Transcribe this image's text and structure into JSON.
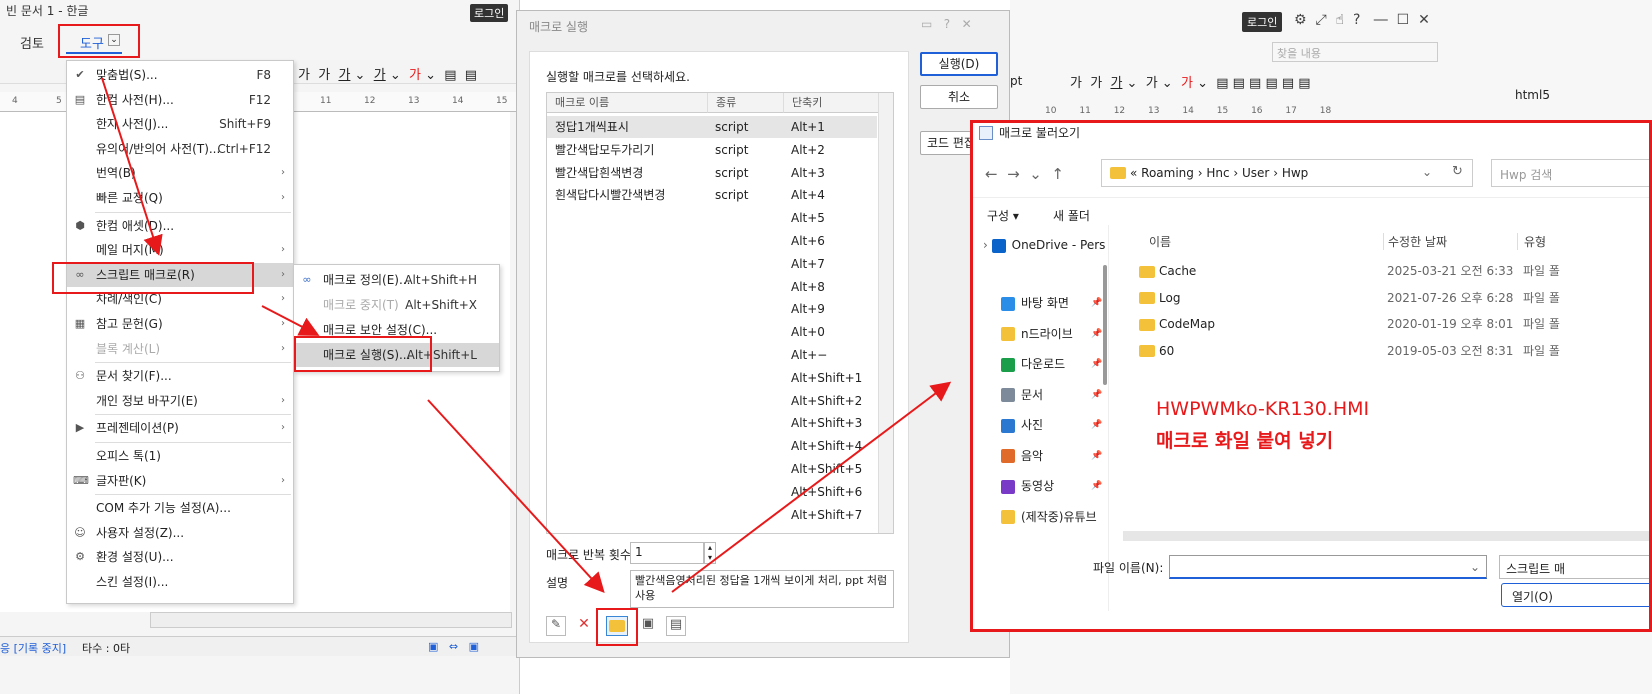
{
  "app": {
    "title": "빈 문서 1 - 한글",
    "login": "로그인",
    "tabs": [
      "검토",
      "도구"
    ],
    "tab_dropdown": "⌄",
    "status_left": "응 [기록 중지]",
    "status_count": "타수 : 0타",
    "ruler_marks": [
      "4",
      "5",
      "6",
      "7",
      "8",
      "9",
      "10",
      "11",
      "12",
      "13",
      "14",
      "15"
    ]
  },
  "menu": {
    "items": [
      {
        "icon": "spell-check-icon",
        "glyph": "✔",
        "label": "맞춤법(S)...",
        "shortcut": "F8",
        "submenu": false,
        "disabled": false
      },
      {
        "icon": "dictionary-icon",
        "glyph": "▤",
        "label": "한컴 사전(H)...",
        "shortcut": "F12",
        "submenu": false,
        "disabled": false
      },
      {
        "icon": "",
        "glyph": "",
        "label": "한자 사전(J)...",
        "shortcut": "Shift+F9",
        "submenu": false,
        "disabled": false
      },
      {
        "icon": "",
        "glyph": "",
        "label": "유의어/반의어 사전(T)...",
        "shortcut": "Ctrl+F12",
        "submenu": false,
        "disabled": false
      },
      {
        "icon": "",
        "glyph": "",
        "label": "번역(B)",
        "shortcut": "",
        "submenu": true,
        "disabled": false
      },
      {
        "icon": "",
        "glyph": "",
        "label": "빠른 교정(Q)",
        "shortcut": "",
        "submenu": true,
        "disabled": false
      },
      {
        "icon": "asset-icon",
        "glyph": "⬢",
        "label": "한컴 애셋(D)...",
        "shortcut": "",
        "submenu": false,
        "disabled": false
      },
      {
        "icon": "",
        "glyph": "",
        "label": "메일 머지(M)",
        "shortcut": "",
        "submenu": true,
        "disabled": false
      },
      {
        "icon": "script-macro-icon",
        "glyph": "∞",
        "label": "스크립트 매크로(R)",
        "shortcut": "",
        "submenu": true,
        "disabled": false
      },
      {
        "icon": "",
        "glyph": "",
        "label": "차례/색인(C)",
        "shortcut": "",
        "submenu": true,
        "disabled": false
      },
      {
        "icon": "reference-icon",
        "glyph": "▦",
        "label": "참고 문헌(G)",
        "shortcut": "",
        "submenu": true,
        "disabled": false
      },
      {
        "icon": "",
        "glyph": "",
        "label": "블록 계산(L)",
        "shortcut": "",
        "submenu": true,
        "disabled": true
      },
      {
        "icon": "binoculars-icon",
        "glyph": "⚇",
        "label": "문서 찾기(F)...",
        "shortcut": "",
        "submenu": false,
        "disabled": false
      },
      {
        "icon": "",
        "glyph": "",
        "label": "개인 정보 바꾸기(E)",
        "shortcut": "",
        "submenu": true,
        "disabled": false
      },
      {
        "icon": "presentation-icon",
        "glyph": "▶",
        "label": "프레젠테이션(P)",
        "shortcut": "",
        "submenu": true,
        "disabled": false
      },
      {
        "icon": "",
        "glyph": "",
        "label": "오피스 톡(1)",
        "shortcut": "",
        "submenu": false,
        "disabled": false
      },
      {
        "icon": "keyboard-icon",
        "glyph": "⌨",
        "label": "글자판(K)",
        "shortcut": "",
        "submenu": true,
        "disabled": false
      },
      {
        "icon": "",
        "glyph": "",
        "label": "COM 추가 기능 설정(A)...",
        "shortcut": "",
        "submenu": false,
        "disabled": false
      },
      {
        "icon": "user-settings-icon",
        "glyph": "☺",
        "label": "사용자 설정(Z)...",
        "shortcut": "",
        "submenu": false,
        "disabled": false
      },
      {
        "icon": "gear-icon",
        "glyph": "⚙",
        "label": "환경 설정(U)...",
        "shortcut": "",
        "submenu": false,
        "disabled": false
      },
      {
        "icon": "",
        "glyph": "",
        "label": "스킨 설정(I)...",
        "shortcut": "",
        "submenu": false,
        "disabled": false
      }
    ]
  },
  "submenu": {
    "items": [
      {
        "label": "매크로 정의(E)...",
        "shortcut": "Alt+Shift+H",
        "disabled": false
      },
      {
        "label": "매크로 중지(T)",
        "shortcut": "Alt+Shift+X",
        "disabled": true
      },
      {
        "label": "매크로 보안 설정(C)...",
        "shortcut": "",
        "disabled": false
      },
      {
        "label": "매크로 실행(S)...",
        "shortcut": "Alt+Shift+L",
        "disabled": false
      }
    ]
  },
  "macro_dialog": {
    "title": "매크로 실행",
    "prompt": "실행할 매크로를 선택하세요.",
    "columns": [
      "매크로 이름",
      "종류",
      "단축키"
    ],
    "rows": [
      {
        "name": "정답1개씩표시",
        "type": "script",
        "key": "Alt+1"
      },
      {
        "name": "빨간색답모두가리기",
        "type": "script",
        "key": "Alt+2"
      },
      {
        "name": "빨간색답흰색변경",
        "type": "script",
        "key": "Alt+3"
      },
      {
        "name": "흰색답다시빨간색변경",
        "type": "script",
        "key": "Alt+4"
      },
      {
        "name": "",
        "type": "",
        "key": "Alt+5"
      },
      {
        "name": "",
        "type": "",
        "key": "Alt+6"
      },
      {
        "name": "",
        "type": "",
        "key": "Alt+7"
      },
      {
        "name": "",
        "type": "",
        "key": "Alt+8"
      },
      {
        "name": "",
        "type": "",
        "key": "Alt+9"
      },
      {
        "name": "",
        "type": "",
        "key": "Alt+0"
      },
      {
        "name": "",
        "type": "",
        "key": "Alt+−"
      },
      {
        "name": "",
        "type": "",
        "key": "Alt+Shift+1"
      },
      {
        "name": "",
        "type": "",
        "key": "Alt+Shift+2"
      },
      {
        "name": "",
        "type": "",
        "key": "Alt+Shift+3"
      },
      {
        "name": "",
        "type": "",
        "key": "Alt+Shift+4"
      },
      {
        "name": "",
        "type": "",
        "key": "Alt+Shift+5"
      },
      {
        "name": "",
        "type": "",
        "key": "Alt+Shift+6"
      },
      {
        "name": "",
        "type": "",
        "key": "Alt+Shift+7"
      }
    ],
    "repeat_label": "매크로 반복 횟수",
    "repeat_value": "1",
    "desc_label": "설명",
    "desc_value": "빨간색음영처리된 정답을 1개씩 보이게 처리, ppt 처럼 사용",
    "run_button": "실행(D)",
    "cancel_button": "취소",
    "code_edit_button": "코드 편집"
  },
  "right_app": {
    "login": "로그인",
    "unit": "pt",
    "search_placeholder": "찾을 내용",
    "tab_label": "html5",
    "ruler_marks": [
      "10",
      "11",
      "12",
      "13",
      "14",
      "15",
      "16",
      "17",
      "18"
    ]
  },
  "file_dialog": {
    "title": "매크로 불러오기",
    "path": [
      "Roaming",
      "Hnc",
      "User",
      "Hwp"
    ],
    "search_placeholder": "Hwp 검색",
    "organize": "구성 ▾",
    "new_folder": "새 폴더",
    "nav_items": [
      {
        "label": "OneDrive - Pers",
        "icon": "onedrive-icon",
        "color": "#0a63c9",
        "pin": false
      },
      {
        "label": "바탕 화면",
        "icon": "desktop-icon",
        "color": "#2a8ee8",
        "pin": true
      },
      {
        "label": "n드라이브",
        "icon": "folder-icon",
        "color": "#f3c13a",
        "pin": true
      },
      {
        "label": "다운로드",
        "icon": "download-icon",
        "color": "#1a9e4a",
        "pin": true
      },
      {
        "label": "문서",
        "icon": "document-icon",
        "color": "#7c8a9a",
        "pin": true
      },
      {
        "label": "사진",
        "icon": "picture-icon",
        "color": "#2a78d0",
        "pin": true
      },
      {
        "label": "음악",
        "icon": "music-icon",
        "color": "#e06a2a",
        "pin": true
      },
      {
        "label": "동영상",
        "icon": "video-icon",
        "color": "#7a3ac8",
        "pin": true
      },
      {
        "label": "(제작중)유튜브",
        "icon": "folder-icon",
        "color": "#f3c13a",
        "pin": false
      }
    ],
    "columns": [
      "이름",
      "수정한 날짜",
      "유형"
    ],
    "files": [
      {
        "name": "Cache",
        "date": "2025-03-21 오전 6:33",
        "type": "파일 폴"
      },
      {
        "name": "Log",
        "date": "2021-07-26 오후 6:28",
        "type": "파일 폴"
      },
      {
        "name": "CodeMap",
        "date": "2020-01-19 오후 8:01",
        "type": "파일 폴"
      },
      {
        "name": "60",
        "date": "2019-05-03 오전 8:31",
        "type": "파일 폴"
      }
    ],
    "filename_label": "파일 이름(N):",
    "filter": "스크립트 매",
    "open_button": "열기(O)"
  },
  "annotation": {
    "line1": "HWPWMko-KR130.HMI",
    "line2": "매크로 화일 붙여 넣기",
    "color": "#e8191a"
  }
}
